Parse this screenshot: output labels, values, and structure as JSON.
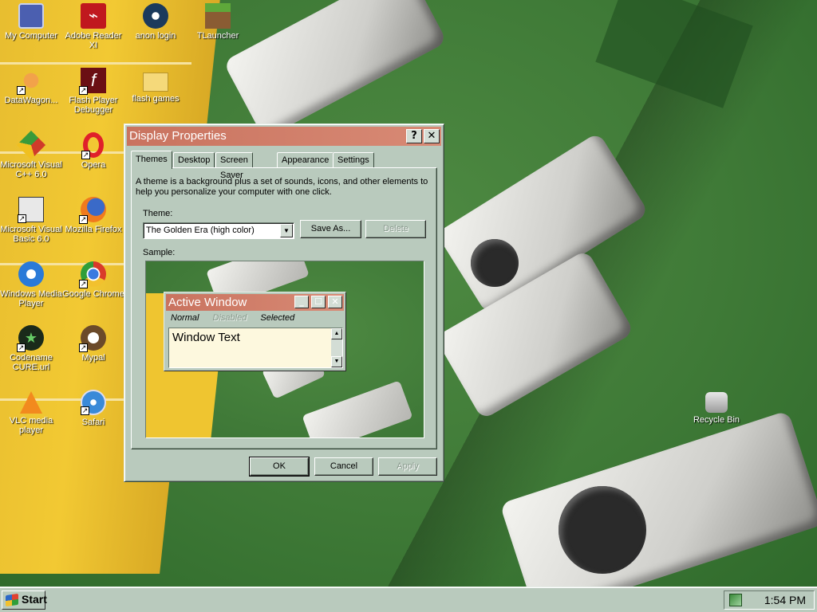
{
  "desktop_icons": [
    {
      "label": "My Computer",
      "icon": "computer-icon",
      "shortcut": false
    },
    {
      "label": "Adobe Reader XI",
      "icon": "pdf-icon",
      "shortcut": false
    },
    {
      "label": "anon login",
      "icon": "steam-icon",
      "shortcut": false
    },
    {
      "label": "TLauncher",
      "icon": "grass-block-icon",
      "shortcut": false
    },
    {
      "label": "DataWagon...",
      "icon": "datawagon-icon",
      "shortcut": true
    },
    {
      "label": "Flash Player Debugger",
      "icon": "flash-icon",
      "shortcut": true
    },
    {
      "label": "flash games",
      "icon": "folder-icon",
      "shortcut": false
    },
    {
      "label": "Microsoft Visual C++ 6.0",
      "icon": "visual-cpp-icon",
      "shortcut": true
    },
    {
      "label": "Opera",
      "icon": "opera-icon",
      "shortcut": true
    },
    {
      "label": "Microsoft Visual Basic 6.0",
      "icon": "visual-basic-icon",
      "shortcut": true
    },
    {
      "label": "Mozilla Firefox",
      "icon": "firefox-icon",
      "shortcut": true
    },
    {
      "label": "Windows Media Player",
      "icon": "media-player-icon",
      "shortcut": true
    },
    {
      "label": "Google Chrome",
      "icon": "chrome-icon",
      "shortcut": true
    },
    {
      "label": "Codename CURE.url",
      "icon": "cure-icon",
      "shortcut": true
    },
    {
      "label": "Mypal",
      "icon": "mypal-icon",
      "shortcut": true
    },
    {
      "label": "VLC media player",
      "icon": "vlc-icon",
      "shortcut": true
    },
    {
      "label": "Safari",
      "icon": "safari-icon",
      "shortcut": true
    },
    {
      "label": "Recycle Bin",
      "icon": "recycle-bin-icon",
      "shortcut": false
    }
  ],
  "window": {
    "title": "Display Properties",
    "help_btn": "?",
    "close_btn": "✕",
    "tabs": [
      "Themes",
      "Desktop",
      "Screen Saver",
      "Appearance",
      "Settings"
    ],
    "active_tab": "Themes",
    "description": "A theme is a background plus a set of sounds, icons, and other elements to help you personalize your computer with one click.",
    "theme_label": "Theme:",
    "theme_value": "The Golden Era (high color)",
    "save_as": "Save As...",
    "delete": "Delete",
    "sample_label": "Sample:",
    "ok": "OK",
    "cancel": "Cancel",
    "apply": "Apply"
  },
  "sample": {
    "title": "Active Window",
    "menu_normal": "Normal",
    "menu_disabled": "Disabled",
    "menu_selected": "Selected",
    "text": "Window Text"
  },
  "taskbar": {
    "start": "Start",
    "clock": "1:54 PM"
  },
  "colors": {
    "face": "#b9cabd",
    "title_active": "#c9735f",
    "text_bg": "#fdf8de"
  }
}
